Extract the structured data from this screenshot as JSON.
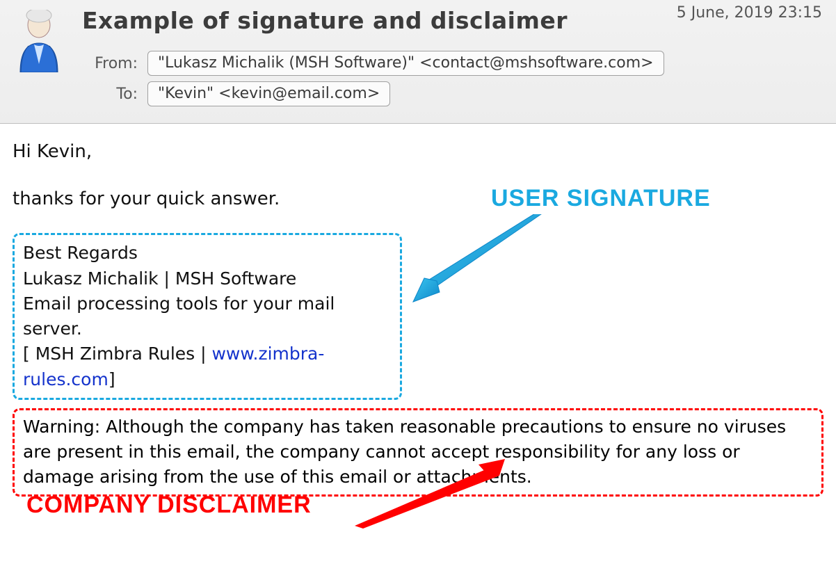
{
  "header": {
    "subject": "Example of signature and disclaimer",
    "date": "5 June, 2019 23:15",
    "from_label": "From:",
    "to_label": "To:",
    "from_value": "\"Lukasz Michalik (MSH Software)\" <contact@mshsoftware.com>",
    "to_value": "\"Kevin\" <kevin@email.com>"
  },
  "body": {
    "greeting": "Hi Kevin,",
    "line1": "thanks for your quick answer."
  },
  "signature": {
    "l1": "Best Regards",
    "l2": "Lukasz Michalik | MSH Software",
    "l3": "Email processing tools for your mail server.",
    "l4_prefix": "[ MSH Zimbra Rules | ",
    "l4_link": "www.zimbra-rules.com",
    "l4_suffix": "]"
  },
  "disclaimer": {
    "text": "Warning: Although the company has taken reasonable precautions to ensure no viruses are present in this email, the company cannot accept responsibility for any loss or damage arising from the use of this email or attachments."
  },
  "annotations": {
    "signature_label": "USER SIGNATURE",
    "disclaimer_label": "COMPANY DISCLAIMER"
  },
  "colors": {
    "signature_accent": "#1aa9e0",
    "disclaimer_accent": "#ff0000",
    "link": "#1433cc"
  }
}
